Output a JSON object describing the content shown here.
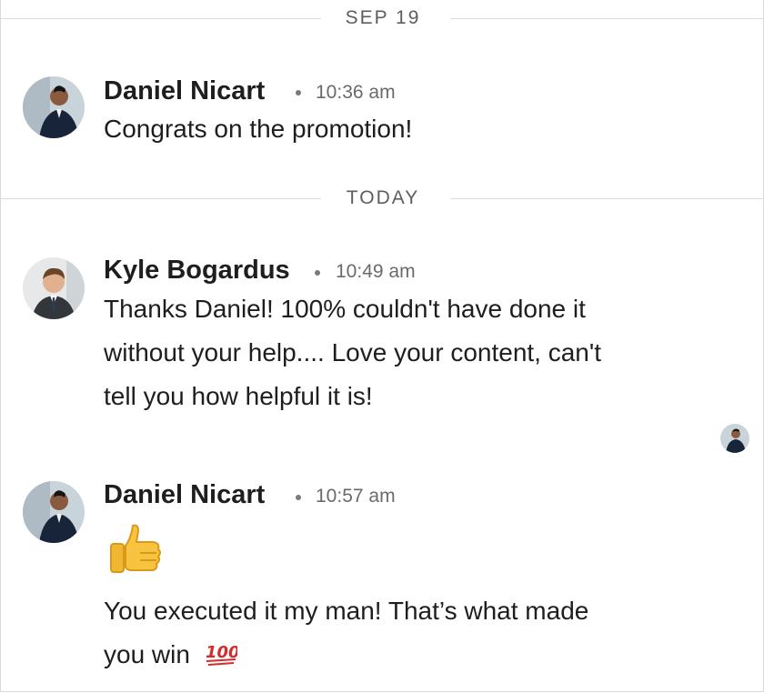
{
  "dividers": [
    {
      "label": "SEP 19"
    },
    {
      "label": "TODAY"
    }
  ],
  "messages": [
    {
      "sender": "Daniel Nicart",
      "time": "10:36 am",
      "text": "Congrats on the promotion!"
    },
    {
      "sender": "Kyle Bogardus",
      "time": "10:49 am",
      "lines": [
        "Thanks Daniel! 100% couldn't have done it",
        "without your help.... Love your content, can't",
        "tell you how helpful it is!"
      ]
    },
    {
      "sender": "Daniel Nicart",
      "time": "10:57 am",
      "emoji": "👍",
      "lines": [
        "You executed it my man! That’s what made",
        "you win"
      ],
      "trailing_emoji": "💯"
    }
  ],
  "icons": {
    "avatar_daniel": "avatar-daniel",
    "avatar_kyle": "avatar-kyle",
    "read_receipt": "read-receipt-avatar"
  },
  "colors": {
    "divider_line": "#dcdcdc",
    "divider_text": "#5e5e5e",
    "name_text": "#1e1e1e",
    "meta_text": "#6a6a6a",
    "hundred_red": "#d72a2a"
  }
}
